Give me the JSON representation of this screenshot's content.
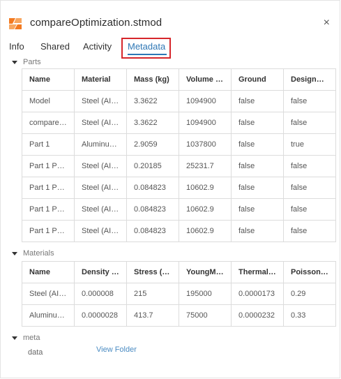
{
  "header": {
    "title": "compareOptimization.stmod",
    "close_label": "×"
  },
  "tabs": [
    {
      "label": "Info"
    },
    {
      "label": "Shared"
    },
    {
      "label": "Activity"
    },
    {
      "label": "Metadata"
    }
  ],
  "parts": {
    "section_label": "Parts",
    "columns": [
      "Name",
      "Material",
      "Mass (kg)",
      "Volume (...",
      "Ground",
      "DesignSp..."
    ],
    "rows": [
      [
        "Model",
        "Steel (AISI...",
        "3.3622",
        "1094900",
        "false",
        "false"
      ],
      [
        "compare_...",
        "Steel (AISI...",
        "3.3622",
        "1094900",
        "false",
        "false"
      ],
      [
        "Part 1",
        "Aluminum...",
        "2.9059",
        "1037800",
        "false",
        "true"
      ],
      [
        "Part 1 Pus...",
        "Steel (AISI...",
        "0.20185",
        "25231.7",
        "false",
        "false"
      ],
      [
        "Part 1 Pus...",
        "Steel (AISI...",
        "0.084823",
        "10602.9",
        "false",
        "false"
      ],
      [
        "Part 1 Pus...",
        "Steel (AISI...",
        "0.084823",
        "10602.9",
        "false",
        "false"
      ],
      [
        "Part 1 Pus...",
        "Steel (AISI...",
        "0.084823",
        "10602.9",
        "false",
        "false"
      ]
    ]
  },
  "materials": {
    "section_label": "Materials",
    "columns": [
      "Name",
      "Density (...",
      "Stress (M...",
      "YoungMo...",
      "Thermale...",
      "Poissonra..."
    ],
    "rows": [
      [
        "Steel (AISI...",
        "0.000008",
        "215",
        "195000",
        "0.0000173",
        "0.29"
      ],
      [
        "Aluminum...",
        "0.0000028",
        "413.7",
        "75000",
        "0.0000232",
        "0.33"
      ]
    ]
  },
  "meta": {
    "section_label": "meta",
    "key": "data",
    "link_label": "View Folder"
  },
  "colors": {
    "accent": "#2e77b5",
    "highlight": "#d6262b",
    "logo_orange": "#f37a21"
  },
  "icons": {
    "logo": "app-logo-icon",
    "close": "close-icon",
    "caret": "caret-down-icon"
  }
}
